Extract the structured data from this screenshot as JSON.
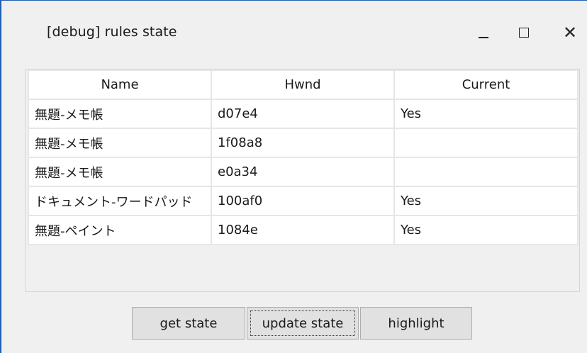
{
  "window": {
    "title": "[debug] rules state",
    "controls": {
      "minimize_glyph": "_",
      "maximize_glyph": "☐",
      "close_glyph": "✕"
    }
  },
  "table": {
    "columns": [
      "Name",
      "Hwnd",
      "Current"
    ],
    "rows": [
      {
        "name": "無題-メモ帳",
        "hwnd": "d07e4",
        "current": "Yes"
      },
      {
        "name": "無題-メモ帳",
        "hwnd": "1f08a8",
        "current": ""
      },
      {
        "name": "無題-メモ帳",
        "hwnd": "e0a34",
        "current": ""
      },
      {
        "name": "ドキュメント-ワードパッド",
        "hwnd": "100af0",
        "current": "Yes"
      },
      {
        "name": "無題-ペイント",
        "hwnd": "1084e",
        "current": "Yes"
      }
    ]
  },
  "buttons": {
    "get_state": "get state",
    "update_state": "update state",
    "highlight": "highlight"
  },
  "colors": {
    "window_bg": "#f0f0f0",
    "border_accent": "#1f5fae",
    "cell_bg": "#ffffff",
    "button_bg": "#e1e1e1"
  }
}
